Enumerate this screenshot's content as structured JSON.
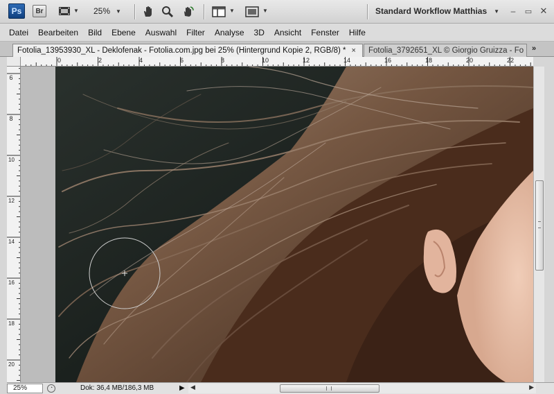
{
  "app": {
    "logo": "Ps",
    "bridge_label": "Br",
    "zoom_level": "25%",
    "workspace": "Standard Workflow Matthias",
    "window_controls": {
      "minimize": "–",
      "restore": "▭",
      "close": "✕"
    }
  },
  "menu": [
    "Datei",
    "Bearbeiten",
    "Bild",
    "Ebene",
    "Auswahl",
    "Filter",
    "Analyse",
    "3D",
    "Ansicht",
    "Fenster",
    "Hilfe"
  ],
  "tabs": [
    {
      "label": "Fotolia_13953930_XL - Deklofenak - Fotolia.com.jpg bei 25% (Hintergrund Kopie 2, RGB/8) *",
      "close": "×",
      "active": true
    },
    {
      "label": "Fotolia_3792651_XL © Giorgio Gruizza - Fo",
      "active": false
    }
  ],
  "tab_overflow": "»",
  "ruler_top_labels": [
    "0",
    "2",
    "4",
    "6",
    "8",
    "10",
    "12",
    "14",
    "16",
    "18",
    "20",
    "22"
  ],
  "ruler_left_labels": [
    "6",
    "8",
    "10",
    "12",
    "14",
    "16",
    "18",
    "20"
  ],
  "status": {
    "zoom": "25%",
    "doc_size": "Dok: 36,4 MB/186,3 MB",
    "menu_arrow": "▶"
  },
  "icons": {
    "film": "film-strip-icon",
    "hand": "hand-tool-icon",
    "zoom": "zoom-tool-icon",
    "rotate": "rotate-view-icon",
    "arrange": "arrange-documents-icon",
    "screen": "screen-mode-icon",
    "brush": "brush-cursor-icon"
  },
  "colors": {
    "ps_blue": "#1f5aa6",
    "background_dark": "#1b211e",
    "hair": "#7a5a44",
    "skin": "#e8c2ad"
  }
}
